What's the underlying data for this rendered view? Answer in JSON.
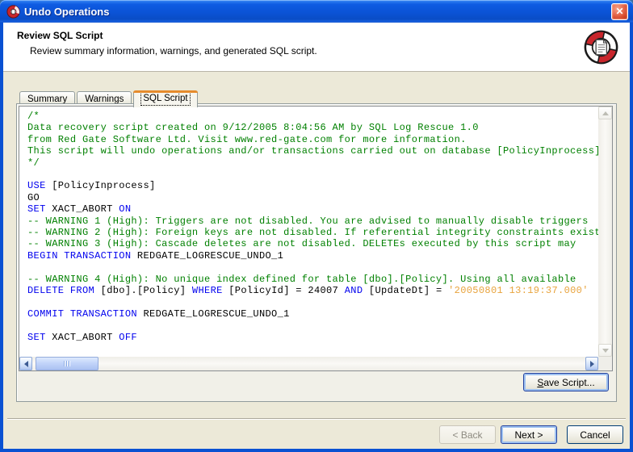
{
  "window": {
    "title": "Undo Operations"
  },
  "header": {
    "title": "Review SQL Script",
    "subtitle": "Review summary information, warnings, and generated SQL script."
  },
  "tabs": [
    {
      "label": "Summary"
    },
    {
      "label": "Warnings"
    },
    {
      "label": "SQL Script",
      "active": true
    }
  ],
  "script": {
    "lines": [
      [
        {
          "t": "/*",
          "c": "c"
        }
      ],
      [
        {
          "t": "Data recovery script created on 9/12/2005 8:04:56 AM by SQL Log Rescue 1.0",
          "c": "c"
        }
      ],
      [
        {
          "t": "from Red Gate Software Ltd. Visit www.red-gate.com for more information.",
          "c": "c"
        }
      ],
      [
        {
          "t": "This script will undo operations and/or transactions carried out on database [PolicyInprocess]",
          "c": "c"
        }
      ],
      [
        {
          "t": "*/",
          "c": "c"
        }
      ],
      [],
      [
        {
          "t": "USE",
          "c": "k"
        },
        {
          "t": " [PolicyInprocess]",
          "c": "p"
        }
      ],
      [
        {
          "t": "GO",
          "c": "p"
        }
      ],
      [
        {
          "t": "SET",
          "c": "k"
        },
        {
          "t": " XACT_ABORT ",
          "c": "p"
        },
        {
          "t": "ON",
          "c": "k"
        }
      ],
      [
        {
          "t": "-- WARNING 1 (High): Triggers are not disabled. You are advised to manually disable triggers",
          "c": "c"
        }
      ],
      [
        {
          "t": "-- WARNING 2 (High): Foreign keys are not disabled. If referential integrity constraints exist",
          "c": "c"
        }
      ],
      [
        {
          "t": "-- WARNING 3 (High): Cascade deletes are not disabled. DELETEs executed by this script may",
          "c": "c"
        }
      ],
      [
        {
          "t": "BEGIN TRANSACTION",
          "c": "k"
        },
        {
          "t": " REDGATE_LOGRESCUE_UNDO_1",
          "c": "p"
        }
      ],
      [],
      [
        {
          "t": "-- WARNING 4 (High): No unique index defined for table [dbo].[Policy]. Using all available",
          "c": "c"
        }
      ],
      [
        {
          "t": "DELETE",
          "c": "k"
        },
        {
          "t": " ",
          "c": "p"
        },
        {
          "t": "FROM",
          "c": "k"
        },
        {
          "t": " [dbo].[Policy] ",
          "c": "p"
        },
        {
          "t": "WHERE",
          "c": "k"
        },
        {
          "t": " [PolicyId] = 24007 ",
          "c": "p"
        },
        {
          "t": "AND",
          "c": "k"
        },
        {
          "t": " [UpdateDt] = ",
          "c": "p"
        },
        {
          "t": "'20050801 13:19:37.000'",
          "c": "s"
        }
      ],
      [],
      [
        {
          "t": "COMMIT TRANSACTION",
          "c": "k"
        },
        {
          "t": " REDGATE_LOGRESCUE_UNDO_1",
          "c": "p"
        }
      ],
      [],
      [
        {
          "t": "SET",
          "c": "k"
        },
        {
          "t": " XACT_ABORT ",
          "c": "p"
        },
        {
          "t": "OFF",
          "c": "k"
        }
      ]
    ]
  },
  "buttons": {
    "save": "Save Script...",
    "back": "< Back",
    "next": "Next >",
    "cancel": "Cancel"
  },
  "icons": {
    "app": "lifebuoy-icon",
    "close": "close-x-icon",
    "logo": "lifebuoy-document-logo"
  },
  "colors": {
    "keyword": "#0000EE",
    "comment": "#008000",
    "string": "#E8A33C",
    "tab_accent": "#E68B2C",
    "titlebar_blue": "#0A51D2",
    "dialog_background": "#ECE9D8",
    "logo_red": "#C9262C"
  }
}
